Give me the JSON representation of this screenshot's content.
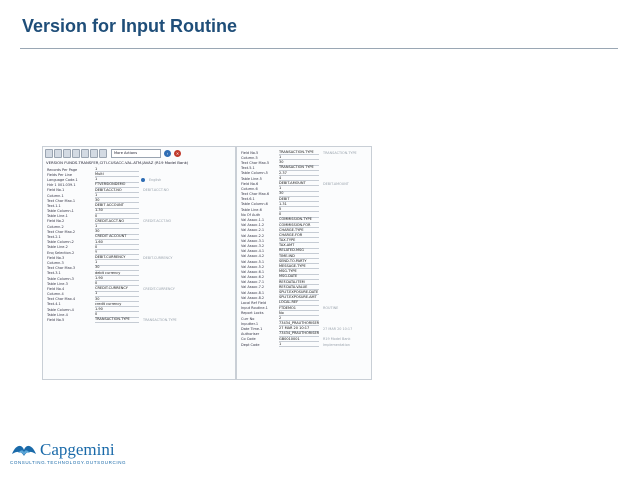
{
  "slide": {
    "title": "Version for Input Routine"
  },
  "left_screenshot": {
    "toolbar": {
      "buttons": [
        "",
        "",
        "",
        "",
        "",
        "",
        ""
      ],
      "actions_select": "More Actions"
    },
    "version_line": "VERSION FUNDS.TRANSFER,CITI.CUSACC.VAL.ATM.JAVAZ (R19 Model Bank)",
    "rows": [
      {
        "label": "Records Per Page",
        "value": "1",
        "note": ""
      },
      {
        "label": "Fields Per Line",
        "value": "MultI",
        "note": ""
      },
      {
        "label": "Language Code.1",
        "value": "1",
        "note": "English"
      },
      {
        "label": "Hdr 1 001.039.1",
        "value": "FTVERSIONDEMO",
        "note": ""
      },
      {
        "label": "Field No.1",
        "value": "DEBIT.ACCT.NO",
        "note": "DEBIT.ACCT.NO"
      },
      {
        "label": "Column.1",
        "value": "1",
        "note": ""
      },
      {
        "label": "Text Char Max.1",
        "value": "30",
        "note": ""
      },
      {
        "label": "Text.1.1",
        "value": "DEBIT ACCOUNT",
        "note": ""
      },
      {
        "label": "Table Column.1",
        "value": "1.30",
        "note": ""
      },
      {
        "label": "Table Line.1",
        "value": "0",
        "note": ""
      },
      {
        "label": "Field No.2",
        "value": "CREDIT.ACCT.NO",
        "note": "CREDIT.ACCT.NO"
      },
      {
        "label": "Column.2",
        "value": "1",
        "note": ""
      },
      {
        "label": "Text Char Max.2",
        "value": "30",
        "note": ""
      },
      {
        "label": "Text.2.1",
        "value": "CREDIT ACCOUNT",
        "note": ""
      },
      {
        "label": "Table Column.2",
        "value": "1.60",
        "note": ""
      },
      {
        "label": "Table Line.2",
        "value": "0",
        "note": ""
      },
      {
        "label": "Enq Selection.2",
        "value": "Y",
        "note": ""
      },
      {
        "label": "Field No.3",
        "value": "DEBIT.CURRENCY",
        "note": "DEBIT.CURRENCY"
      },
      {
        "label": "Column.3",
        "value": "1",
        "note": ""
      },
      {
        "label": "Text Char Max.3",
        "value": "30",
        "note": ""
      },
      {
        "label": "Text.3.1",
        "value": "debit currency",
        "note": ""
      },
      {
        "label": "Table Column.3",
        "value": "1.90",
        "note": ""
      },
      {
        "label": "Table Line.3",
        "value": "0",
        "note": ""
      },
      {
        "label": "Field No.4",
        "value": "CREDIT.CURRENCY",
        "note": "CREDIT.CURRENCY"
      },
      {
        "label": "Column.4",
        "value": "1",
        "note": ""
      },
      {
        "label": "Text Char Max.4",
        "value": "30",
        "note": ""
      },
      {
        "label": "Text.4.1",
        "value": "credit currency",
        "note": ""
      },
      {
        "label": "Table Column.4",
        "value": "1.90",
        "note": ""
      },
      {
        "label": "Table Line.4",
        "value": "0",
        "note": ""
      },
      {
        "label": "Field No.5",
        "value": "TRANSACTION.TYPE",
        "note": "TRANSACTION.TYPE"
      }
    ]
  },
  "right_screenshot": {
    "rows": [
      {
        "label": "Field No.5",
        "value": "TRANSACTION.TYPE",
        "note": "TRANSACTION.TYPE"
      },
      {
        "label": "Column.5",
        "value": "1",
        "note": ""
      },
      {
        "label": "Text Char Max.5",
        "value": "30",
        "note": ""
      },
      {
        "label": "Text.5.1",
        "value": "TRANSACTION TYPE",
        "note": ""
      },
      {
        "label": "Table Column.5",
        "value": "2.37",
        "note": ""
      },
      {
        "label": "Table Line.5",
        "value": "4",
        "note": ""
      },
      {
        "label": "Field No.6",
        "value": "DEBIT.AMOUNT",
        "note": "DEBIT.AMOUNT"
      },
      {
        "label": "Column.6",
        "value": "1",
        "note": ""
      },
      {
        "label": "Text Char Max.6",
        "value": "30",
        "note": ""
      },
      {
        "label": "Text.6.1",
        "value": "DEBIT",
        "note": ""
      },
      {
        "label": "Table Column.6",
        "value": "1.31",
        "note": ""
      },
      {
        "label": "Table Line.6",
        "value": "5",
        "note": ""
      },
      {
        "label": "No Of Auth",
        "value": "0",
        "note": ""
      },
      {
        "label": "Val Assoc.1.1",
        "value": "COMMISSION.TYPE",
        "note": ""
      },
      {
        "label": "Val Assoc.1.2",
        "value": "COMMISSION.FOR",
        "note": ""
      },
      {
        "label": "Val Assoc.2.1",
        "value": "CHARGE.TYPE",
        "note": ""
      },
      {
        "label": "Val Assoc.2.2",
        "value": "CHARGE.FOR",
        "note": ""
      },
      {
        "label": "Val Assoc.3.1",
        "value": "TAX.TYPE",
        "note": ""
      },
      {
        "label": "Val Assoc.3.2",
        "value": "TAX.AMT",
        "note": ""
      },
      {
        "label": "Val Assoc.4.1",
        "value": "RELATED.MSG",
        "note": ""
      },
      {
        "label": "Val Assoc.4.2",
        "value": "TIME.IND",
        "note": ""
      },
      {
        "label": "Val Assoc.5.1",
        "value": "SEND.TO.PARTY",
        "note": ""
      },
      {
        "label": "Val Assoc.5.2",
        "value": "MESSAGE.TYPE",
        "note": ""
      },
      {
        "label": "Val Assoc.6.1",
        "value": "MSG.TYPE",
        "note": ""
      },
      {
        "label": "Val Assoc.6.2",
        "value": "MSG.DATE",
        "note": ""
      },
      {
        "label": "Val Assoc.7.1",
        "value": "REF.DATA.ITEM",
        "note": ""
      },
      {
        "label": "Val Assoc.7.2",
        "value": "REF.DATA.VALUE",
        "note": ""
      },
      {
        "label": "Val Assoc.8.1",
        "value": "SPLIT.EXPOSURE.DATE",
        "note": ""
      },
      {
        "label": "Val Assoc.8.2",
        "value": "SPLIT.EXPOSURE.AMT",
        "note": ""
      },
      {
        "label": "Local Ref Field",
        "value": "LOCAL.REF",
        "note": ""
      },
      {
        "label": "Input Routine.1",
        "value": "FTDEMO1",
        "note": "ROUTINE"
      },
      {
        "label": "Report Locks",
        "value": "No",
        "note": ""
      },
      {
        "label": "Curr No",
        "value": "2",
        "note": ""
      },
      {
        "label": "Inputter.1",
        "value": "73434_PRAUTHORISER",
        "note": ""
      },
      {
        "label": "Date Time.1",
        "value": "27 MAR 20 10:17",
        "note": "27 MAR 20 10:17"
      },
      {
        "label": "Authoriser",
        "value": "73434_PRAUTHORISER",
        "note": ""
      },
      {
        "label": "Co Code",
        "value": "GB0010001",
        "note": "R19 Model Bank"
      },
      {
        "label": "Dept Code",
        "value": "1",
        "note": "Implementation"
      }
    ]
  },
  "footer": {
    "logo_text": "Capgemini",
    "tagline": "CONSULTING.TECHNOLOGY.OUTSOURCING"
  },
  "colors": {
    "title": "#1f4e79",
    "logo": "#1a6aa9"
  }
}
